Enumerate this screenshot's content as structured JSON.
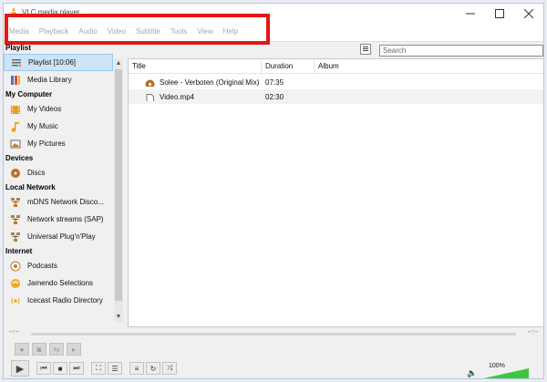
{
  "window": {
    "title": "VLC media player"
  },
  "menu": {
    "items": [
      "Media",
      "Playback",
      "Audio",
      "Video",
      "Subtitle",
      "Tools",
      "View",
      "Help"
    ]
  },
  "sidebar": {
    "sections": [
      {
        "heading": "Playlist",
        "items": [
          {
            "label": "Playlist [10:06]",
            "icon": "playlist-icon",
            "selected": true
          },
          {
            "label": "Media Library",
            "icon": "media-library-icon"
          }
        ]
      },
      {
        "heading": "My Computer",
        "items": [
          {
            "label": "My Videos",
            "icon": "video-folder-icon"
          },
          {
            "label": "My Music",
            "icon": "music-note-icon"
          },
          {
            "label": "My Pictures",
            "icon": "picture-icon"
          }
        ]
      },
      {
        "heading": "Devices",
        "items": [
          {
            "label": "Discs",
            "icon": "disc-icon"
          }
        ]
      },
      {
        "heading": "Local Network",
        "items": [
          {
            "label": "mDNS Network Disco...",
            "icon": "network-icon"
          },
          {
            "label": "Network streams (SAP)",
            "icon": "network-icon"
          },
          {
            "label": "Universal Plug'n'Play",
            "icon": "network-icon"
          }
        ]
      },
      {
        "heading": "Internet",
        "items": [
          {
            "label": "Podcasts",
            "icon": "podcast-icon"
          },
          {
            "label": "Jamendo Selections",
            "icon": "jamendo-icon"
          },
          {
            "label": "Icecast Radio Directory",
            "icon": "radio-icon"
          }
        ]
      }
    ]
  },
  "search": {
    "placeholder": "Search",
    "value": ""
  },
  "table": {
    "columns": [
      "Title",
      "Duration",
      "Album"
    ],
    "rows": [
      {
        "title": "Solee - Verboten (Original Mix)",
        "duration": "07:35",
        "album": "",
        "icon": "audio-file-icon"
      },
      {
        "title": "Video.mp4",
        "duration": "02:30",
        "album": "",
        "icon": "video-file-icon"
      }
    ]
  },
  "seek": {
    "elapsed": "--:--",
    "remaining": "--:--"
  },
  "volume": {
    "label": "100%",
    "level": 1.0
  },
  "colors": {
    "accent": "#ff8800",
    "volume": "#3ec73e",
    "highlight": "#e11818"
  }
}
